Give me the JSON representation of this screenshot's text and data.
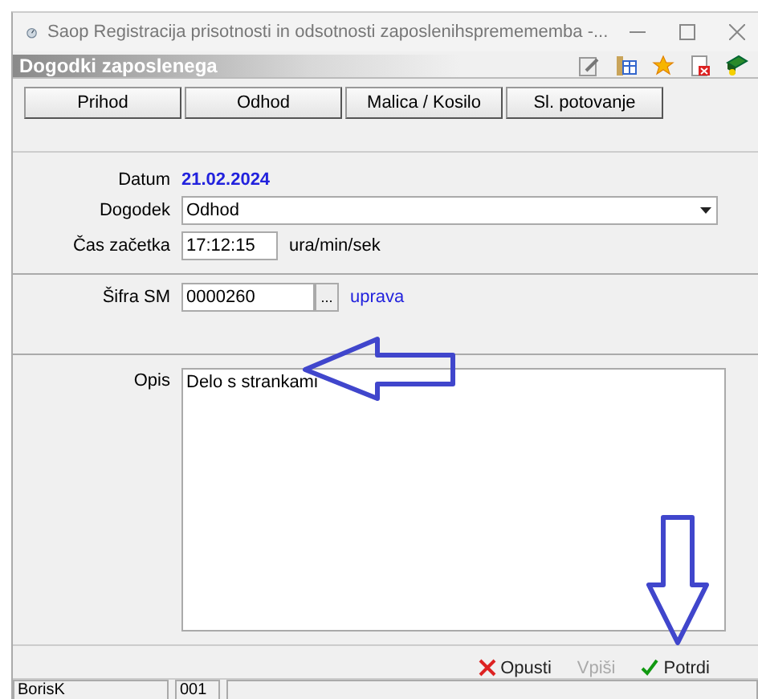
{
  "window": {
    "title": "Saop Registracija prisotnosti in odsotnosti zaposlenihspremememba -..."
  },
  "header": {
    "title": "Dogodki zaposlenega"
  },
  "event_buttons": [
    {
      "label": "Prihod"
    },
    {
      "label": "Odhod"
    },
    {
      "label": "Malica / Kosilo"
    },
    {
      "label": "Sl. potovanje"
    }
  ],
  "form": {
    "date_label": "Datum",
    "date_value": "21.02.2024",
    "event_label": "Dogodek",
    "event_value": "Odhod",
    "time_label": "Čas začetka",
    "time_value": "17:12:15",
    "time_unit": "ura/min/sek",
    "code_label": "Šifra SM",
    "code_value": "0000260",
    "code_browse": "...",
    "code_link": "uprava",
    "description_label": "Opis",
    "description_value": "Delo s strankami"
  },
  "footer_buttons": [
    {
      "kind": "cancel",
      "label": "Opusti",
      "disabled": false
    },
    {
      "kind": "plain",
      "label": "Vpiši",
      "disabled": true
    },
    {
      "kind": "confirm",
      "label": "Potrdi",
      "disabled": false
    }
  ],
  "status_bar": [
    "BorisK",
    "001"
  ]
}
